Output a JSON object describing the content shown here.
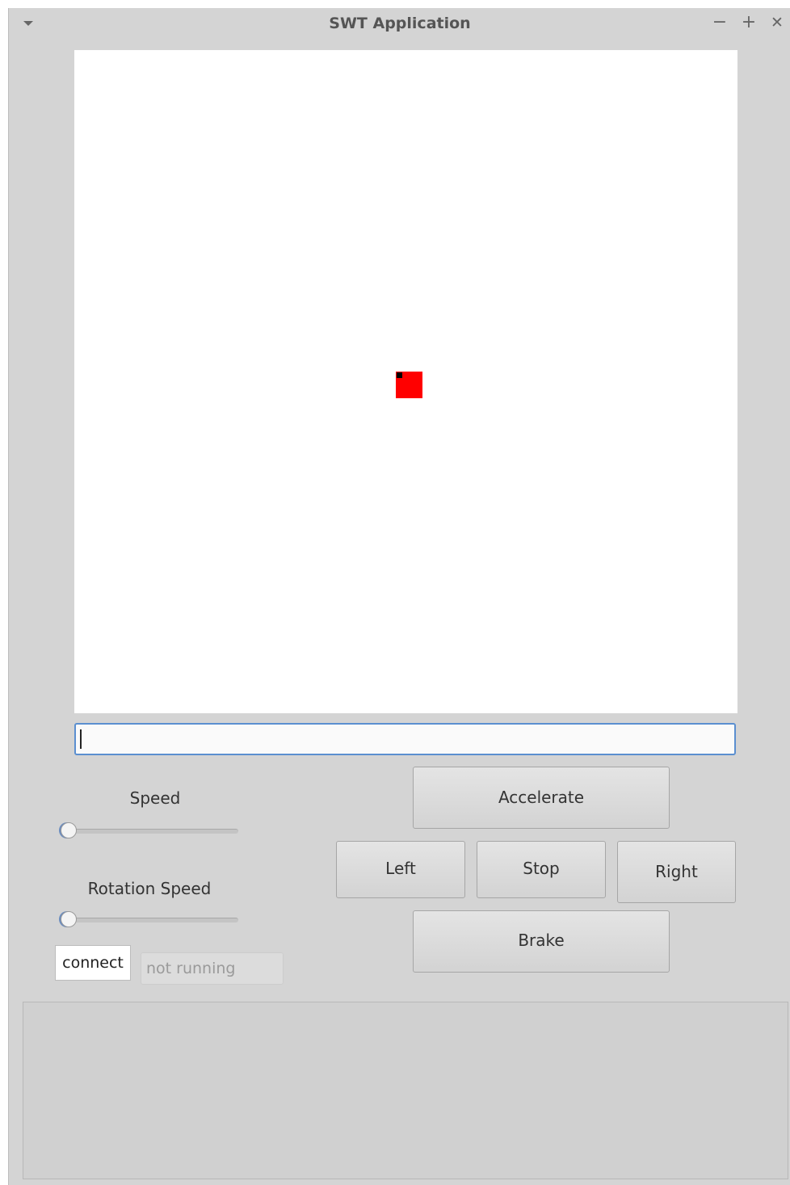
{
  "window": {
    "title": "SWT Application",
    "controls": {
      "minimize": "−",
      "maximize": "+",
      "close": "✕"
    }
  },
  "canvas": {
    "robot_color": "#ff0000",
    "robot_marker_color": "#000000"
  },
  "command_input": {
    "value": "",
    "placeholder": ""
  },
  "sliders": {
    "speed": {
      "label": "Speed",
      "value": 0
    },
    "rotation_speed": {
      "label": "Rotation Speed",
      "value": 0
    }
  },
  "controls": {
    "accelerate": "Accelerate",
    "left": "Left",
    "stop": "Stop",
    "right": "Right",
    "brake": "Brake"
  },
  "connection": {
    "button_label": "connect",
    "status_placeholder": "not running"
  },
  "log": {
    "text": ""
  }
}
